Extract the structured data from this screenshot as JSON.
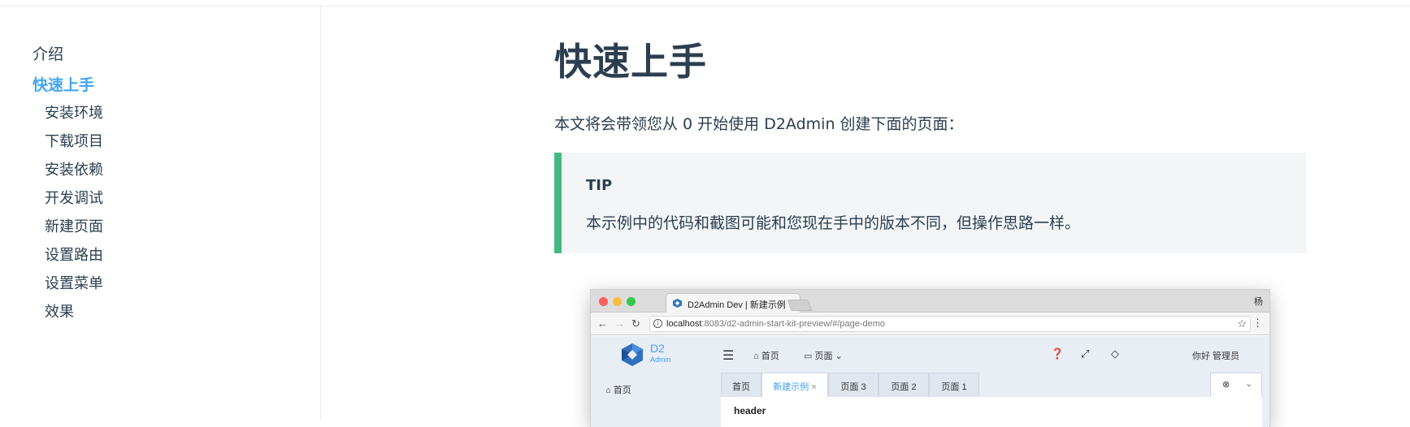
{
  "sidebar": {
    "items": [
      {
        "label": "介绍",
        "level": 1,
        "active": false
      },
      {
        "label": "快速上手",
        "level": 1,
        "active": true
      },
      {
        "label": "安装环境",
        "level": 2
      },
      {
        "label": "下载项目",
        "level": 2
      },
      {
        "label": "安装依赖",
        "level": 2
      },
      {
        "label": "开发调试",
        "level": 2
      },
      {
        "label": "新建页面",
        "level": 2
      },
      {
        "label": "设置路由",
        "level": 2
      },
      {
        "label": "设置菜单",
        "level": 2
      },
      {
        "label": "效果",
        "level": 2
      }
    ],
    "active_color": "#42a5f5"
  },
  "main": {
    "title": "快速上手",
    "intro": "本文将会带领您从 0 开始使用 D2Admin 创建下面的页面：",
    "tip": {
      "title": "TIP",
      "text": "本示例中的代码和截图可能和您现在手中的版本不同，但操作思路一样。",
      "accent_color": "#42b983"
    }
  },
  "screenshot": {
    "browser_tab_title": "D2Admin Dev | 新建示例",
    "browser_tab_close": "×",
    "browser_user": "杨",
    "url_host": "localhost",
    "url_rest": ":8083/d2-admin-start-kit-preview/#/page-demo",
    "app": {
      "logo_title": "D2",
      "logo_subtitle": "Admin",
      "nav": [
        {
          "icon": "home-icon",
          "glyph": "⌂",
          "label": "首页"
        },
        {
          "icon": "folder-icon",
          "glyph": "▭",
          "label": "页面",
          "caret": "⌄"
        }
      ],
      "header_icons": [
        "question-icon",
        "fullscreen-icon",
        "diamond-icon"
      ],
      "greeting": "你好 管理员",
      "side_home": "首页",
      "tabs": [
        {
          "label": "首页",
          "active": false
        },
        {
          "label": "新建示例",
          "active": true,
          "close": "×"
        },
        {
          "label": "页面 3",
          "active": false
        },
        {
          "label": "页面 2",
          "active": false
        },
        {
          "label": "页面 1",
          "active": false
        }
      ],
      "content_text": "header",
      "accent_color": "#409eff"
    }
  }
}
